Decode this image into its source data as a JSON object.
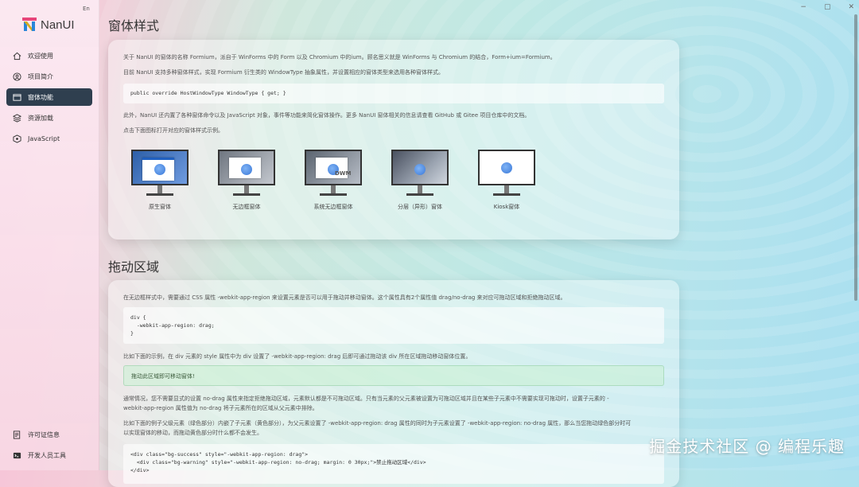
{
  "app": {
    "name": "NanUI",
    "lang_toggle": "En"
  },
  "window_controls": {
    "minimize": "−",
    "maximize": "▢",
    "close": "✕"
  },
  "sidebar": {
    "items": [
      {
        "label": "欢迎使用",
        "icon": "home-icon"
      },
      {
        "label": "项目简介",
        "icon": "about-icon"
      },
      {
        "label": "窗体功能",
        "icon": "window-icon",
        "active": true
      },
      {
        "label": "资源加载",
        "icon": "layers-icon"
      },
      {
        "label": "JavaScript",
        "icon": "js-icon"
      }
    ],
    "bottom_items": [
      {
        "label": "许可证信息",
        "icon": "license-icon"
      },
      {
        "label": "开发人员工具",
        "icon": "devtools-icon"
      }
    ]
  },
  "section1": {
    "title": "窗体样式",
    "p1": "关于 NanUI 的窗体的名称 Formium，派自于 WinForms 中的 Form 以及 Chromium 中的ium。顾名思义就是 WinForms 与 Chromium 的结合，Form+ium=Formium。",
    "p2": "目前 NanUI 支持多种窗体样式，实现 Formium 衍生类的 WindowType 抽象属性，并设置相应的窗体类型来选用各种窗体样式。",
    "code": "public override HostWindowType WindowType { get; }",
    "p3": "此外，NanUI 还内置了各种窗体命令以及 JavaScript 对象，事件等功能来简化窗体操作。更多 NanUI 窗体相关的信息请查看 GitHub 或 Gitee 项目仓库中的文档。",
    "p4": "点击下面图标打开对应的窗体样式示例。",
    "styles": [
      {
        "label": "原生窗体"
      },
      {
        "label": "无边框窗体"
      },
      {
        "label": "系统无边框窗体",
        "badge": "DWM"
      },
      {
        "label": "分层（异形）窗体"
      },
      {
        "label": "Kiosk窗体"
      }
    ]
  },
  "section2": {
    "title": "拖动区域",
    "p1": "在无边框样式中，需要通过 CSS 属性 -webkit-app-region 来设置元素是否可以用于拖动并移动窗体。这个属性具有2个属性值 drag/no-drag 来对应可拖动区域和拒绝拖动区域。",
    "code_lines": [
      "div {",
      "  -webkit-app-region: drag;",
      "}"
    ],
    "p2": "比如下面的示例，在 div 元素的 style 属性中为 div 设置了 -webkit-app-region: drag 后即可通过拖动该 div 所在区域拖动移动窗体位置。",
    "demo": "拖动此区域即可移动窗体!",
    "p3a": "通常情况，您不需要显式的设置 no-drag 属性来指定拒绝拖动区域，元素默认都是不可拖动区域。只有当元素的父元素被设置为可拖动区域并且在某些子元素中不需要实现可拖动时，设置子元素的 -",
    "p3b": "webkit-app-region 属性值为 no-drag 将子元素所在的区域从父元素中排除。",
    "p4a": "比如下面的例子父级元素（绿色部分）内嵌了子元素（黄色部分），为父元素设置了 -webkit-app-region: drag 属性的同时为子元素设置了 -webkit-app-region: no-drag 属性，那么当您拖动绿色部分时可",
    "p4b": "以实现窗体的移动，而拖动黄色部分时什么都不会发生。",
    "code2_lines": [
      "<div class=\"bg-success\" style=\"-webkit-app-region: drag\">",
      "  <div class=\"bg-warning\" style=\"-webkit-app-region: no-drag; margin: 0 30px;\">禁止拖动区域</div>",
      "</div>"
    ]
  },
  "watermark": "掘金技术社区 @ 编程乐趣"
}
